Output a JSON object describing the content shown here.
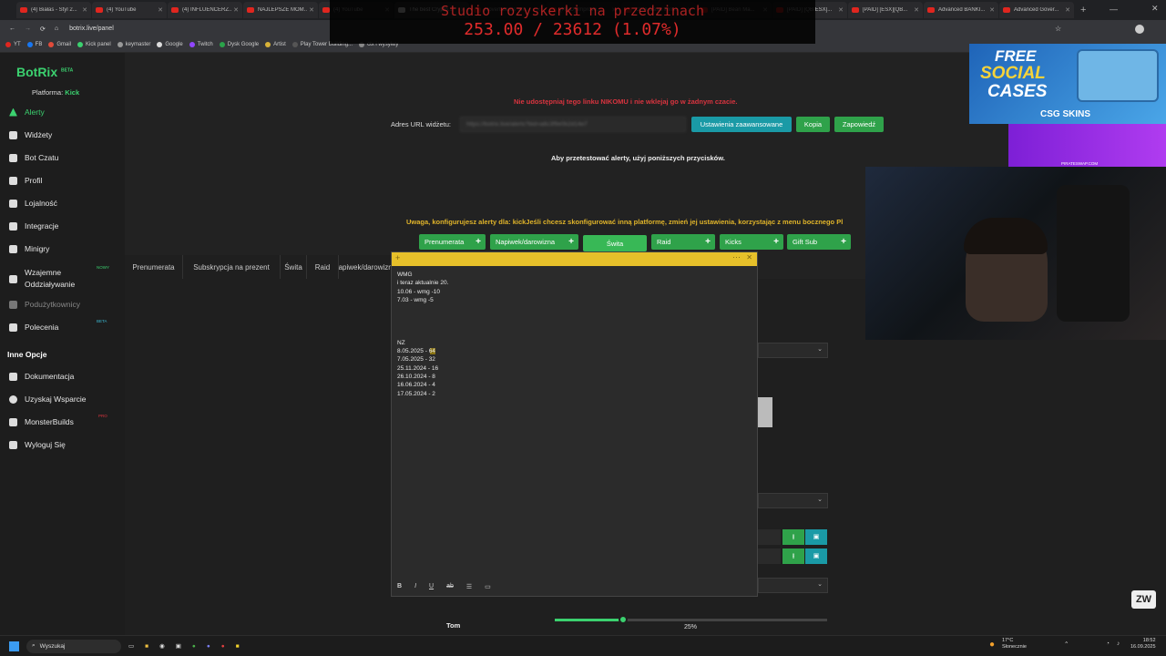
{
  "browser": {
    "tabs": [
      "(4) Białas - Styl 2...",
      "(4) YouTube",
      "(4) INFLUENCERZ...",
      "NAJLEPSZE MOM...",
      "(4) YouTube",
      "The best Crypto...",
      "Hoverboards Sn...",
      "[PAID] Improve...",
      "ONX Casa Imm...",
      "[PAID] Bean Ma...",
      "[PAID] [QB/ESX]...",
      "[PAID] [ESX][QB...",
      "Advanced BANKI...",
      "Advanced Gover..."
    ],
    "url": "botrix.live/panel",
    "bookmarks": [
      "YT",
      "FB",
      "Gmail",
      "Kick panel",
      "keymaster",
      "Google",
      "Twitch",
      "Dysk Google",
      "Artist",
      "Play Tower Building...",
      "ctx i wysyłwy"
    ]
  },
  "overlay": {
    "title": "Studio rozyskerki na przedzinach",
    "counter": "253.00 / 23612 (1.07%)",
    "ad_line1": "FREE",
    "ad_line2": "SOCIAL",
    "ad_line3": "CASES",
    "ad_brand": "CSG SKINS",
    "purple_text": "PIRATESWAP.COM",
    "watermark": "ZW"
  },
  "sidebar": {
    "logo": "BotRix",
    "beta": "BETA",
    "platform_label": "Platforma:",
    "platform_value": "Kick",
    "items": [
      {
        "label": "Alerty",
        "icon": "warning-icon"
      },
      {
        "label": "Widżety",
        "icon": "grid-icon"
      },
      {
        "label": "Bot Czatu",
        "icon": "chat-icon"
      },
      {
        "label": "Profil",
        "icon": "profile-icon"
      },
      {
        "label": "Lojalność",
        "icon": "trophy-icon"
      },
      {
        "label": "Integracje",
        "icon": "integration-icon"
      },
      {
        "label": "Minigry",
        "icon": "gamepad-icon"
      },
      {
        "label": "Wzajemne Oddziaływanie",
        "icon": "music-icon",
        "badge": "NOWY"
      },
      {
        "label": "Podużytkownicy",
        "icon": "users-icon"
      },
      {
        "label": "Polecenia",
        "icon": "referral-icon",
        "badge": "BETA"
      }
    ],
    "section_title": "Inne Opcje",
    "other_items": [
      {
        "label": "Dokumentacja",
        "icon": "doc-icon"
      },
      {
        "label": "Uzyskaj Wsparcie",
        "icon": "help-icon"
      },
      {
        "label": "MonsterBuilds",
        "icon": "monitor-icon",
        "badge": "PRO"
      },
      {
        "label": "Wyloguj Się",
        "icon": "logout-icon"
      }
    ]
  },
  "main": {
    "warning": "Nie udostępniaj tego linku NIKOMU i nie wklejaj go w żadnym czacie.",
    "url_label": "Adres URL widżetu:",
    "url_value": "https://botrix.live/alerts?bid=a8c3f9e0b2d14e7",
    "adv_button": "Ustawienia zaawansowane",
    "copy_button": "Kopia",
    "preview_button": "Zapowiedź",
    "test_text": "Aby przetestować alerty, użyj poniższych przycisków.",
    "test_buttons": [
      "Prenumerata",
      "Napiwek/darowizna",
      "Świta",
      "Raid",
      "Kicks",
      "Gift Sub"
    ],
    "notice": "Uwaga, konfigurujesz alerty dla: kickJeśli chcesz skonfigurować inną platformę, zmień jej ustawienia, korzystając z menu bocznego Pl",
    "subtabs": [
      "Prenumerata",
      "Subskrypcja na prezent",
      "Świta",
      "Raid",
      "Napiwek/darowizna"
    ],
    "slider_label": "Tom",
    "slider_value": "25%",
    "slider_fraction": 0.25
  },
  "note": {
    "lines_top": [
      "WMG",
      "i teraz aktualnie 20.",
      "10.06 - wmg -10",
      "7.03 - wmg -5"
    ],
    "lines_bottom_title": "NZ",
    "lines_bottom": [
      "8.05.2025 - 64",
      "7.05.2025 - 32",
      "25.11.2024 - 16",
      "26.10.2024 - 8",
      "16.06.2024 - 4",
      "17.05.2024 - 2"
    ],
    "toolbar": [
      "B",
      "I",
      "U",
      "ab",
      "list",
      "image"
    ]
  },
  "taskbar": {
    "search": "Wyszukaj",
    "weather_temp": "17°C",
    "weather_desc": "Słonecznie",
    "time": "18:52",
    "date": "16.09.2025"
  }
}
